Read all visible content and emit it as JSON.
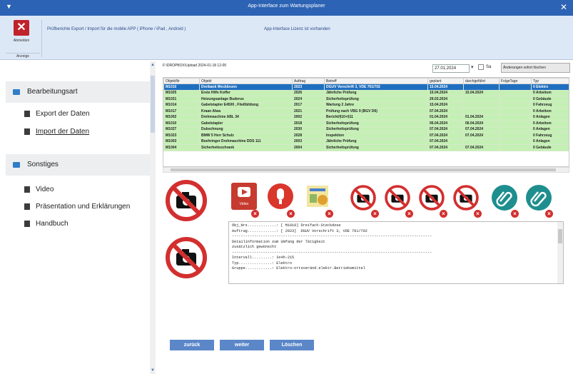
{
  "window": {
    "title": "App-Interface zum Wartungsplaner",
    "menu_glyph": "▼",
    "close_glyph": "✕"
  },
  "ribbon": {
    "close_button_label": "Abmelden",
    "group_label": "Anzeige",
    "text1": "Prüfberichte Export / Import für die mobile APP  ( iPhone / iPad , Android )",
    "text2": "App-Interface Lizenz ist vorhanden"
  },
  "sidebar": {
    "section1": "Bearbeitungsart",
    "items1": [
      "Export der Daten",
      "Import  der Daten"
    ],
    "section2": "Sonstiges",
    "items2": [
      "Video",
      "Präsentation und Erklärungen",
      "Handbuch"
    ]
  },
  "toolbar": {
    "path": "F:\\DROPBOX\\Upload 2024-01-18 12-00",
    "date": "27.01.2024",
    "checkbox_label": "Sa",
    "changes_button": "Änderungen sofort löschen"
  },
  "grid": {
    "columns": [
      "ObjektNr",
      "Objekt",
      "Auftrag",
      "Betreff",
      "geplant",
      "durchgeführt",
      "FolgeTage",
      "Typ"
    ],
    "rows": [
      [
        "M1010",
        "Dreibank Weckbrunn",
        "2023",
        "DGUV Vorschrift 3, VDE 701/702",
        "15.04.2024",
        "",
        "",
        "0 Elektro"
      ],
      [
        "M1025",
        "Erste Hilfe Koffer",
        "2026",
        "Jährliche Prüfung",
        "15.04.2024",
        "15.04.2024",
        "",
        "0 Arbeitsm"
      ],
      [
        "M1021",
        "Heizungsanlage Buderus",
        "2024",
        "Sicherheitsprüfung",
        "29.03.2024",
        "",
        "",
        "0 Gebäude"
      ],
      [
        "M1014",
        "Gabelstapler E4500 , Fließbildung",
        "2017",
        "Wartung 2 Jahre",
        "15.04.2024",
        "",
        "",
        "0 Fahrzeug"
      ],
      [
        "M1017",
        "Kraan Alwa",
        "2021",
        "Prüfung nach VBG 9 (BGV D6)",
        "07.04.2024",
        "",
        "",
        "0 Arbeitsm"
      ],
      [
        "M1002",
        "Drehmaschine ABL 34",
        "2002",
        "Bericht/§10+§11",
        "01.04.2024",
        "01.04.2024",
        "",
        "0 Anlagen"
      ],
      [
        "M1010",
        "Gabelstapler",
        "2018",
        "Sicherheitsprüfung",
        "06.04.2024",
        "06.04.2024",
        "",
        "0 Arbeitsm"
      ],
      [
        "M1027",
        "Dubschnung",
        "2030",
        "Sicherheitsprüfung",
        "07.04.2024",
        "07.04.2024",
        "",
        "0 Anlagen"
      ],
      [
        "M1023",
        "BMW 5 Herr Schulz",
        "2028",
        "Inspektion",
        "07.04.2024",
        "07.04.2024",
        "",
        "0 Fahrzeug"
      ],
      [
        "M1003",
        "Boehringer Drehmaschine DDS 111",
        "2003",
        "Jährliche Prüfung",
        "07.04.2024",
        "",
        "",
        "0 Anlagen"
      ],
      [
        "M1004",
        "Sicherheitsschrank",
        "2004",
        "Sicherheitsprüfung",
        "07.04.2024",
        "07.04.2024",
        "",
        "0 Gebäude"
      ]
    ]
  },
  "textbox": {
    "lines": [
      "Obj_Nrs.............: [ M1010] Dreifach-Steckdose",
      "Auftrag.............: [ 2023]  DGUV Vorschrift 3, VDE 701/702",
      "------------------------------------------------------------------------------------------",
      "Detailinformation zum Umfang der Tätigkeit",
      "zusätzlich gewünscht",
      "------------------------------------------------------------------------------------------",
      "Intervall.........: 3x4h-215",
      "Typ...............: Elektro",
      "Gruppe............: Elektro-ortsveränd.elektr.Betriebsmittel"
    ]
  },
  "media": {
    "video_label": "Video"
  },
  "buttons": {
    "back": "zurück",
    "next": "weiter",
    "delete": "Löschen"
  }
}
